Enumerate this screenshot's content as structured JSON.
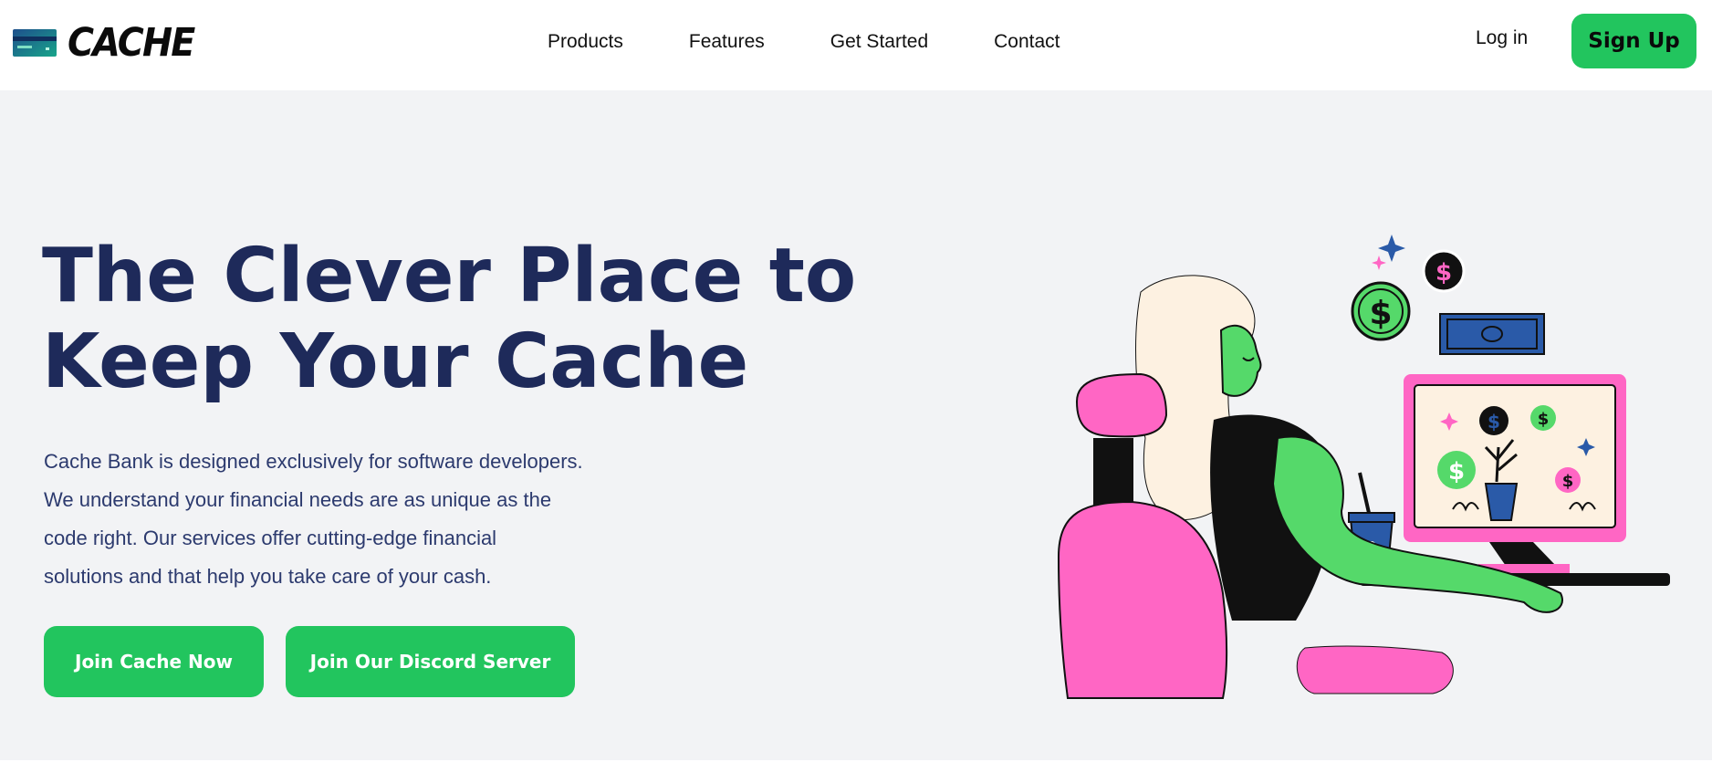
{
  "brand": {
    "name": "CACHE",
    "icon": "credit-card-icon"
  },
  "nav": {
    "links": [
      "Products",
      "Features",
      "Get Started",
      "Contact"
    ],
    "login": "Log in",
    "signup": "Sign Up"
  },
  "hero": {
    "title_lines": [
      "The Clever Place to",
      "Keep Your Cache"
    ],
    "description_lines": [
      "Cache Bank is designed exclusively for software developers.",
      "We understand your financial needs are as unique as the",
      "code right. Our services offer cutting-edge financial",
      "solutions and that help you take care of your cash."
    ],
    "primary_cta": "Join Cache Now",
    "secondary_cta": "Join Our Discord Server",
    "illustration": "woman-at-computer-illustration"
  },
  "colors": {
    "accent": "#22c55e",
    "heading": "#1e2a5a",
    "body_text": "#2c3a6e",
    "background": "#f2f3f5",
    "pink": "#ff66c4",
    "green_skin": "#55d96a",
    "blue": "#2a5aa8"
  }
}
